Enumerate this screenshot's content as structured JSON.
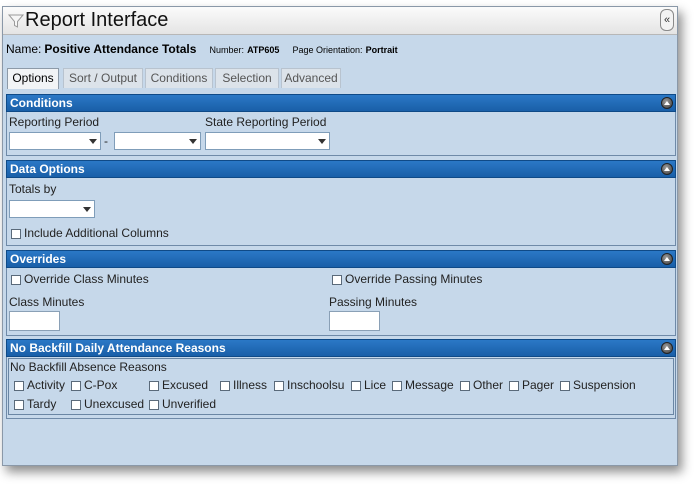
{
  "window": {
    "title": "Report Interface",
    "collapse_glyph": "«"
  },
  "report": {
    "name_label": "Name:",
    "name": "Positive Attendance Totals",
    "number_label": "Number:",
    "number": "ATP605",
    "orientation_label": "Page Orientation:",
    "orientation": "Portrait"
  },
  "tabs": [
    {
      "label": "Options",
      "active": true
    },
    {
      "label": "Sort / Output",
      "active": false
    },
    {
      "label": "Conditions",
      "active": false
    },
    {
      "label": "Selection",
      "active": false
    },
    {
      "label": "Advanced",
      "active": false
    }
  ],
  "conditions": {
    "header": "Conditions",
    "reporting_period_label": "Reporting Period",
    "range_separator": "-",
    "state_reporting_period_label": "State Reporting Period",
    "reporting_period_from": "",
    "reporting_period_to": "",
    "state_reporting_period": ""
  },
  "data_options": {
    "header": "Data Options",
    "totals_by_label": "Totals by",
    "totals_by_value": "",
    "include_additional_columns_label": "Include Additional Columns",
    "include_additional_columns_checked": false
  },
  "overrides": {
    "header": "Overrides",
    "override_class_minutes_label": "Override Class Minutes",
    "override_passing_minutes_label": "Override Passing Minutes",
    "class_minutes_label": "Class Minutes",
    "passing_minutes_label": "Passing Minutes",
    "class_minutes_value": "",
    "passing_minutes_value": ""
  },
  "no_backfill": {
    "header": "No Backfill Daily Attendance Reasons",
    "group_label": "No Backfill Absence Reasons",
    "reasons": [
      "Activity",
      "C-Pox",
      "Excused",
      "Illness",
      "Inschoolsu",
      "Lice",
      "Message",
      "Other",
      "Pager",
      "Suspension",
      "Tardy",
      "Unexcused",
      "Unverified"
    ]
  },
  "icons": {
    "filter": "funnel-icon",
    "collapse": "double-chevron-left-icon",
    "section_toggle": "collapse-section-icon",
    "dropdown": "chevron-down-icon"
  },
  "colors": {
    "section_header": "#1f65ad",
    "window_background": "#c6d8ea"
  }
}
